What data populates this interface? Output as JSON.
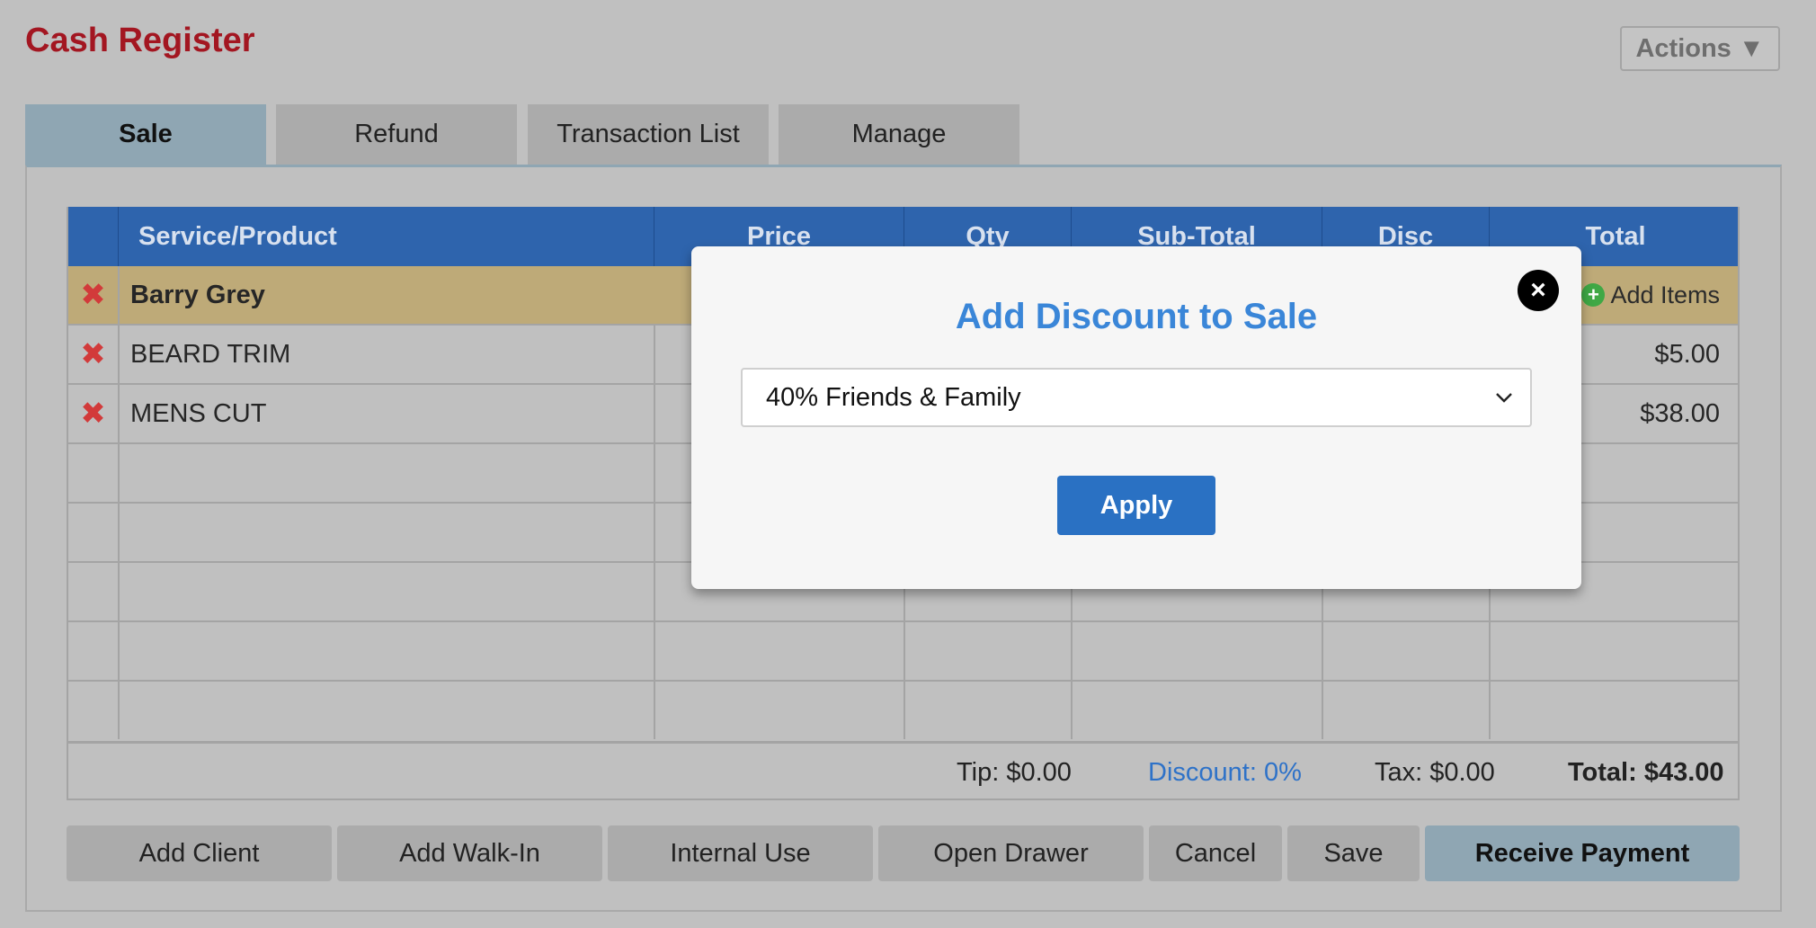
{
  "app": {
    "title": "Cash Register",
    "actions_label": "Actions",
    "actions_icon": "▼"
  },
  "tabs": [
    {
      "label": "Sale",
      "active": true
    },
    {
      "label": "Refund",
      "active": false
    },
    {
      "label": "Transaction List",
      "active": false
    },
    {
      "label": "Manage",
      "active": false
    }
  ],
  "table": {
    "columns": [
      "",
      "Service/Product",
      "Price",
      "Qty",
      "Sub-Total",
      "Disc",
      "Total"
    ],
    "client_row": {
      "name": "Barry Grey",
      "add_items_label": "Add Items"
    },
    "items": [
      {
        "name": "BEARD TRIM",
        "total": "$5.00"
      },
      {
        "name": "MENS CUT",
        "total": "$38.00"
      }
    ],
    "footer": {
      "tip": "Tip: $0.00",
      "discount": "Discount: 0%",
      "tax": "Tax: $0.00",
      "total": "Total: $43.00"
    }
  },
  "buttons": {
    "add_client": "Add Client",
    "add_walk_in": "Add Walk-In",
    "internal_use": "Internal Use",
    "open_drawer": "Open Drawer",
    "cancel": "Cancel",
    "save": "Save",
    "receive_payment": "Receive Payment"
  },
  "modal": {
    "title": "Add Discount to Sale",
    "select_value": "40% Friends & Family",
    "apply_label": "Apply",
    "close_icon": "×"
  },
  "colors": {
    "title_red": "#a31621",
    "header_blue": "#2e64ad",
    "client_row": "#beaa78",
    "active_tab": "#8fa6b3",
    "modal_title": "#3a86d8",
    "apply_button": "#2a71c3",
    "discount_text": "#2e72c8"
  }
}
